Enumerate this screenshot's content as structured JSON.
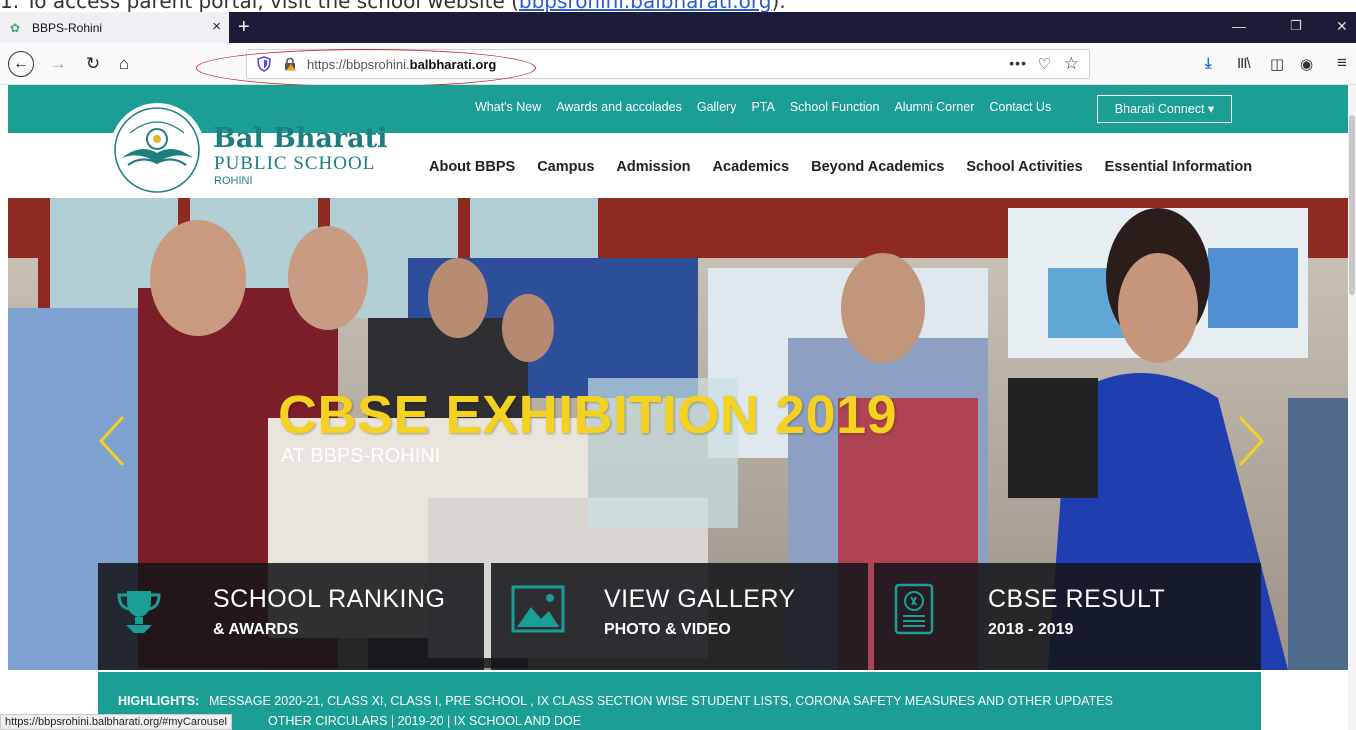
{
  "doc": {
    "text_prefix": "1.   To access parent portal, visit the school website (",
    "link_text": "bbpsrohini.balbharati.org",
    "text_suffix": ")."
  },
  "browser": {
    "tab_title": "BBPS-Rohini",
    "tab_close": "×",
    "new_tab": "+",
    "url_prefix": "https://bbpsrohini.",
    "url_domain": "balbharati.org",
    "url_more": "•••",
    "status_url": "https://bbpsrohini.balbharati.org/#myCarousel"
  },
  "site": {
    "top_nav": [
      "What's New",
      "Awards and accolades",
      "Gallery",
      "PTA",
      "School Function",
      "Alumni Corner",
      "Contact Us"
    ],
    "connect_label": "Bharati Connect ▾",
    "logo": {
      "name": "Bal Bharati",
      "sub": "PUBLIC SCHOOL",
      "city": "ROHINI"
    },
    "main_nav": [
      "About BBPS",
      "Campus",
      "Admission",
      "Academics",
      "Beyond Academics",
      "School Activities",
      "Essential Information"
    ],
    "hero": {
      "title": "CBSE EXHIBITION 2019",
      "subtitle": "AT BBPS-ROHINI"
    },
    "features": [
      {
        "title": "SCHOOL RANKING",
        "sub": "& AWARDS"
      },
      {
        "title": "VIEW GALLERY",
        "sub": "PHOTO & VIDEO"
      },
      {
        "title": "CBSE RESULT",
        "sub": "2018 - 2019"
      }
    ],
    "highlights": {
      "label": "HIGHLIGHTS:",
      "text": "MESSAGE 2020-21, CLASS XI, CLASS I,  PRE SCHOOL  ,  IX CLASS SECTION WISE STUDENT LISTS, CORONA SAFETY MEASURES AND OTHER UPDATES",
      "text2": "OTHER CIRCULARS | 2019-20 | IX SCHOOL AND DOE"
    }
  },
  "colors": {
    "teal": "#1a9e96",
    "hero_title": "#f5d21f",
    "annotation": "#c0262b"
  }
}
